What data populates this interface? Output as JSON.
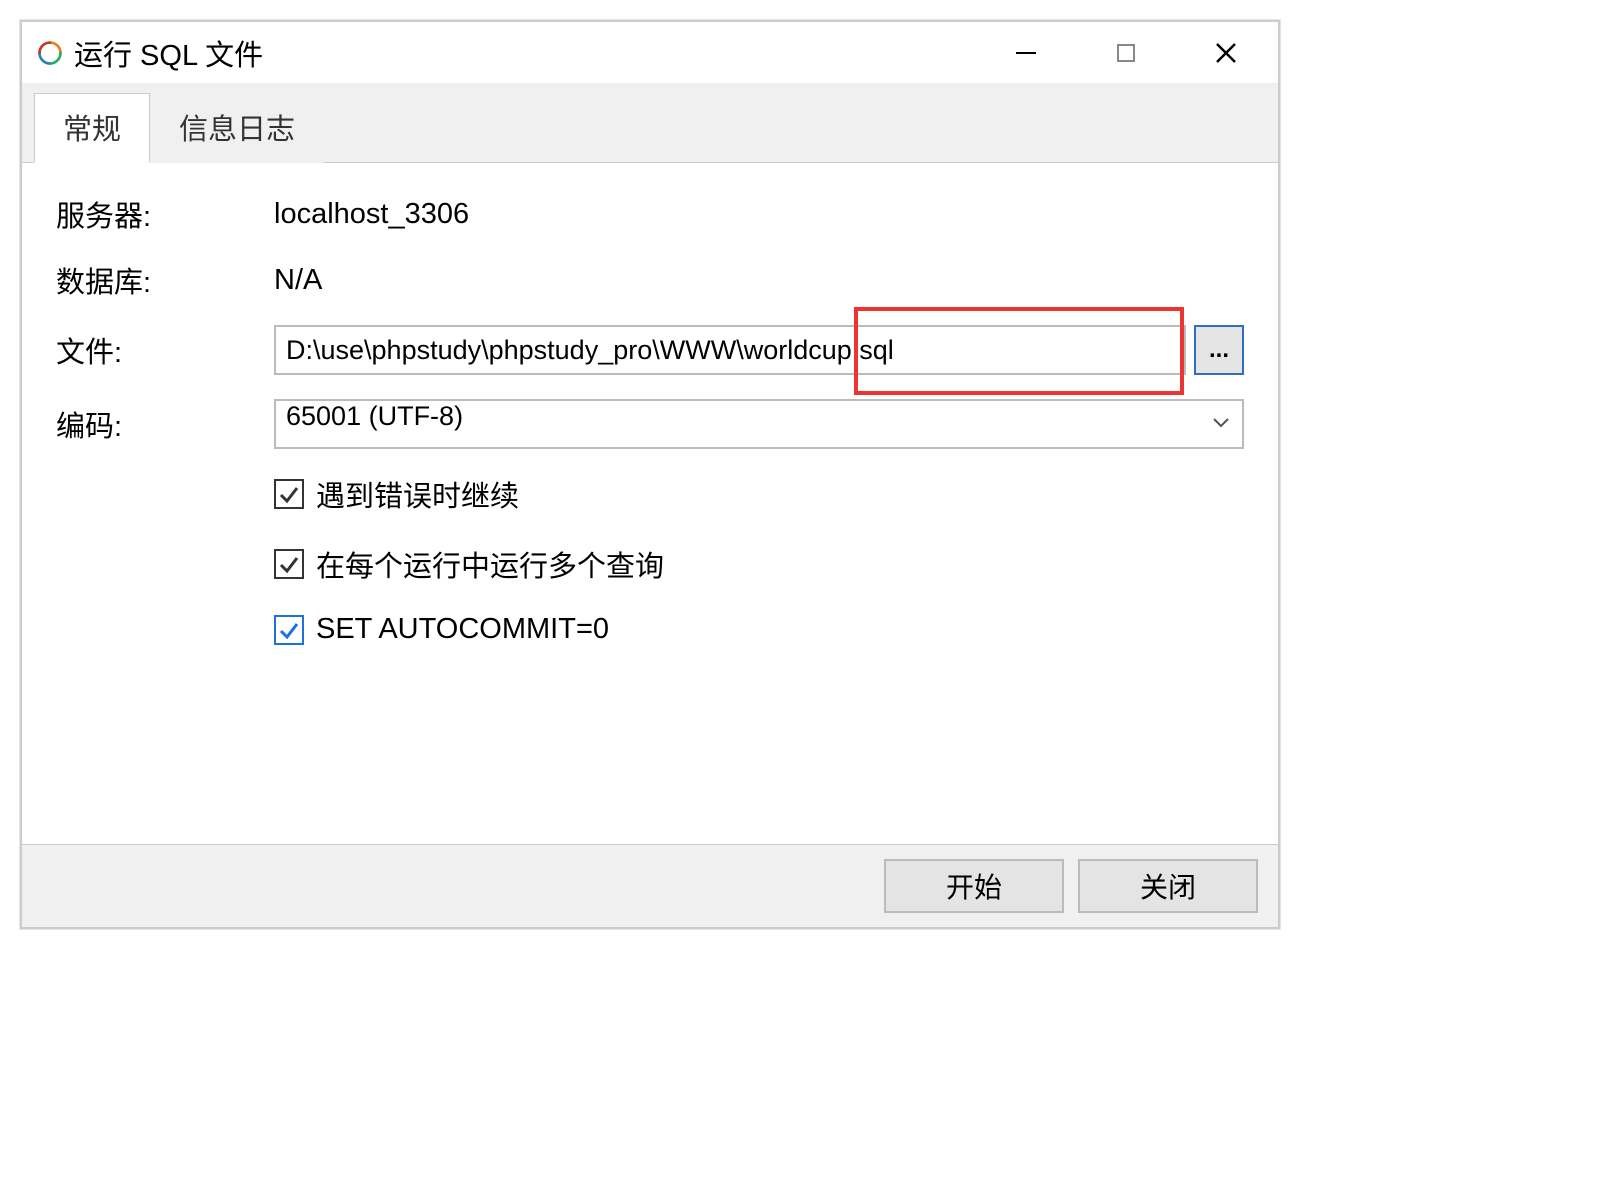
{
  "window": {
    "title": "运行 SQL 文件"
  },
  "tabs": {
    "general": "常规",
    "log": "信息日志"
  },
  "form": {
    "server_label": "服务器:",
    "server_value": "localhost_3306",
    "database_label": "数据库:",
    "database_value": "N/A",
    "file_label": "文件:",
    "file_value": "D:\\use\\phpstudy\\phpstudy_pro\\WWW\\worldcup.sql",
    "browse_label": "...",
    "encoding_label": "编码:",
    "encoding_value": "65001 (UTF-8)"
  },
  "options": {
    "continue_on_error": "遇到错误时继续",
    "multi_query": "在每个运行中运行多个查询",
    "set_autocommit": "SET AUTOCOMMIT=0"
  },
  "footer": {
    "start": "开始",
    "close": "关闭"
  }
}
